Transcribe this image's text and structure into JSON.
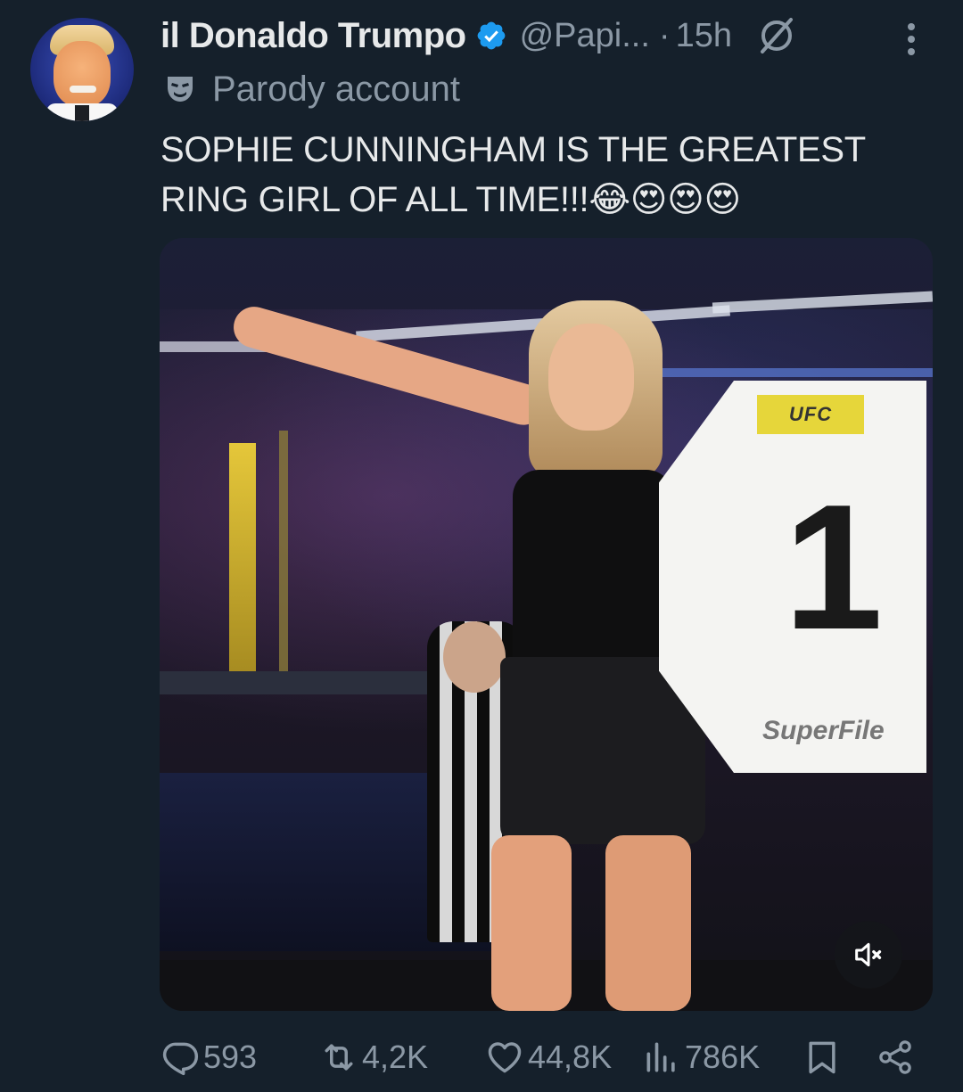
{
  "author": {
    "display_name": "il Donaldo Trumpo",
    "handle": "@Papi...",
    "separator": "·",
    "time_ago": "15h",
    "verified": true,
    "parody_label": "Parody account",
    "avatar_icon": "avatar-portrait"
  },
  "tweet": {
    "text": "SOPHIE CUNNINGHAM IS THE GREATEST RING GIRL OF ALL TIME!!!😂😍😍😍"
  },
  "media": {
    "type": "video",
    "sign_brand_top": "UFC",
    "sign_number": "1",
    "sign_brand_bottom": "SuperFile",
    "muted": true
  },
  "actions": {
    "replies": "593",
    "reposts": "4,2K",
    "likes": "44,8K",
    "views": "786K"
  },
  "colors": {
    "background": "#15202b",
    "primary_text": "#e7e9ea",
    "secondary_text": "#8b98a5",
    "verified_blue": "#1d9bf0"
  },
  "icons": {
    "verified": "verified-badge-icon",
    "grok": "grok-icon",
    "more": "more-icon",
    "parody": "theater-mask-icon",
    "mute": "volume-muted-icon",
    "reply": "reply-icon",
    "repost": "repost-icon",
    "like": "heart-icon",
    "views": "views-icon",
    "bookmark": "bookmark-icon",
    "share": "share-icon"
  }
}
